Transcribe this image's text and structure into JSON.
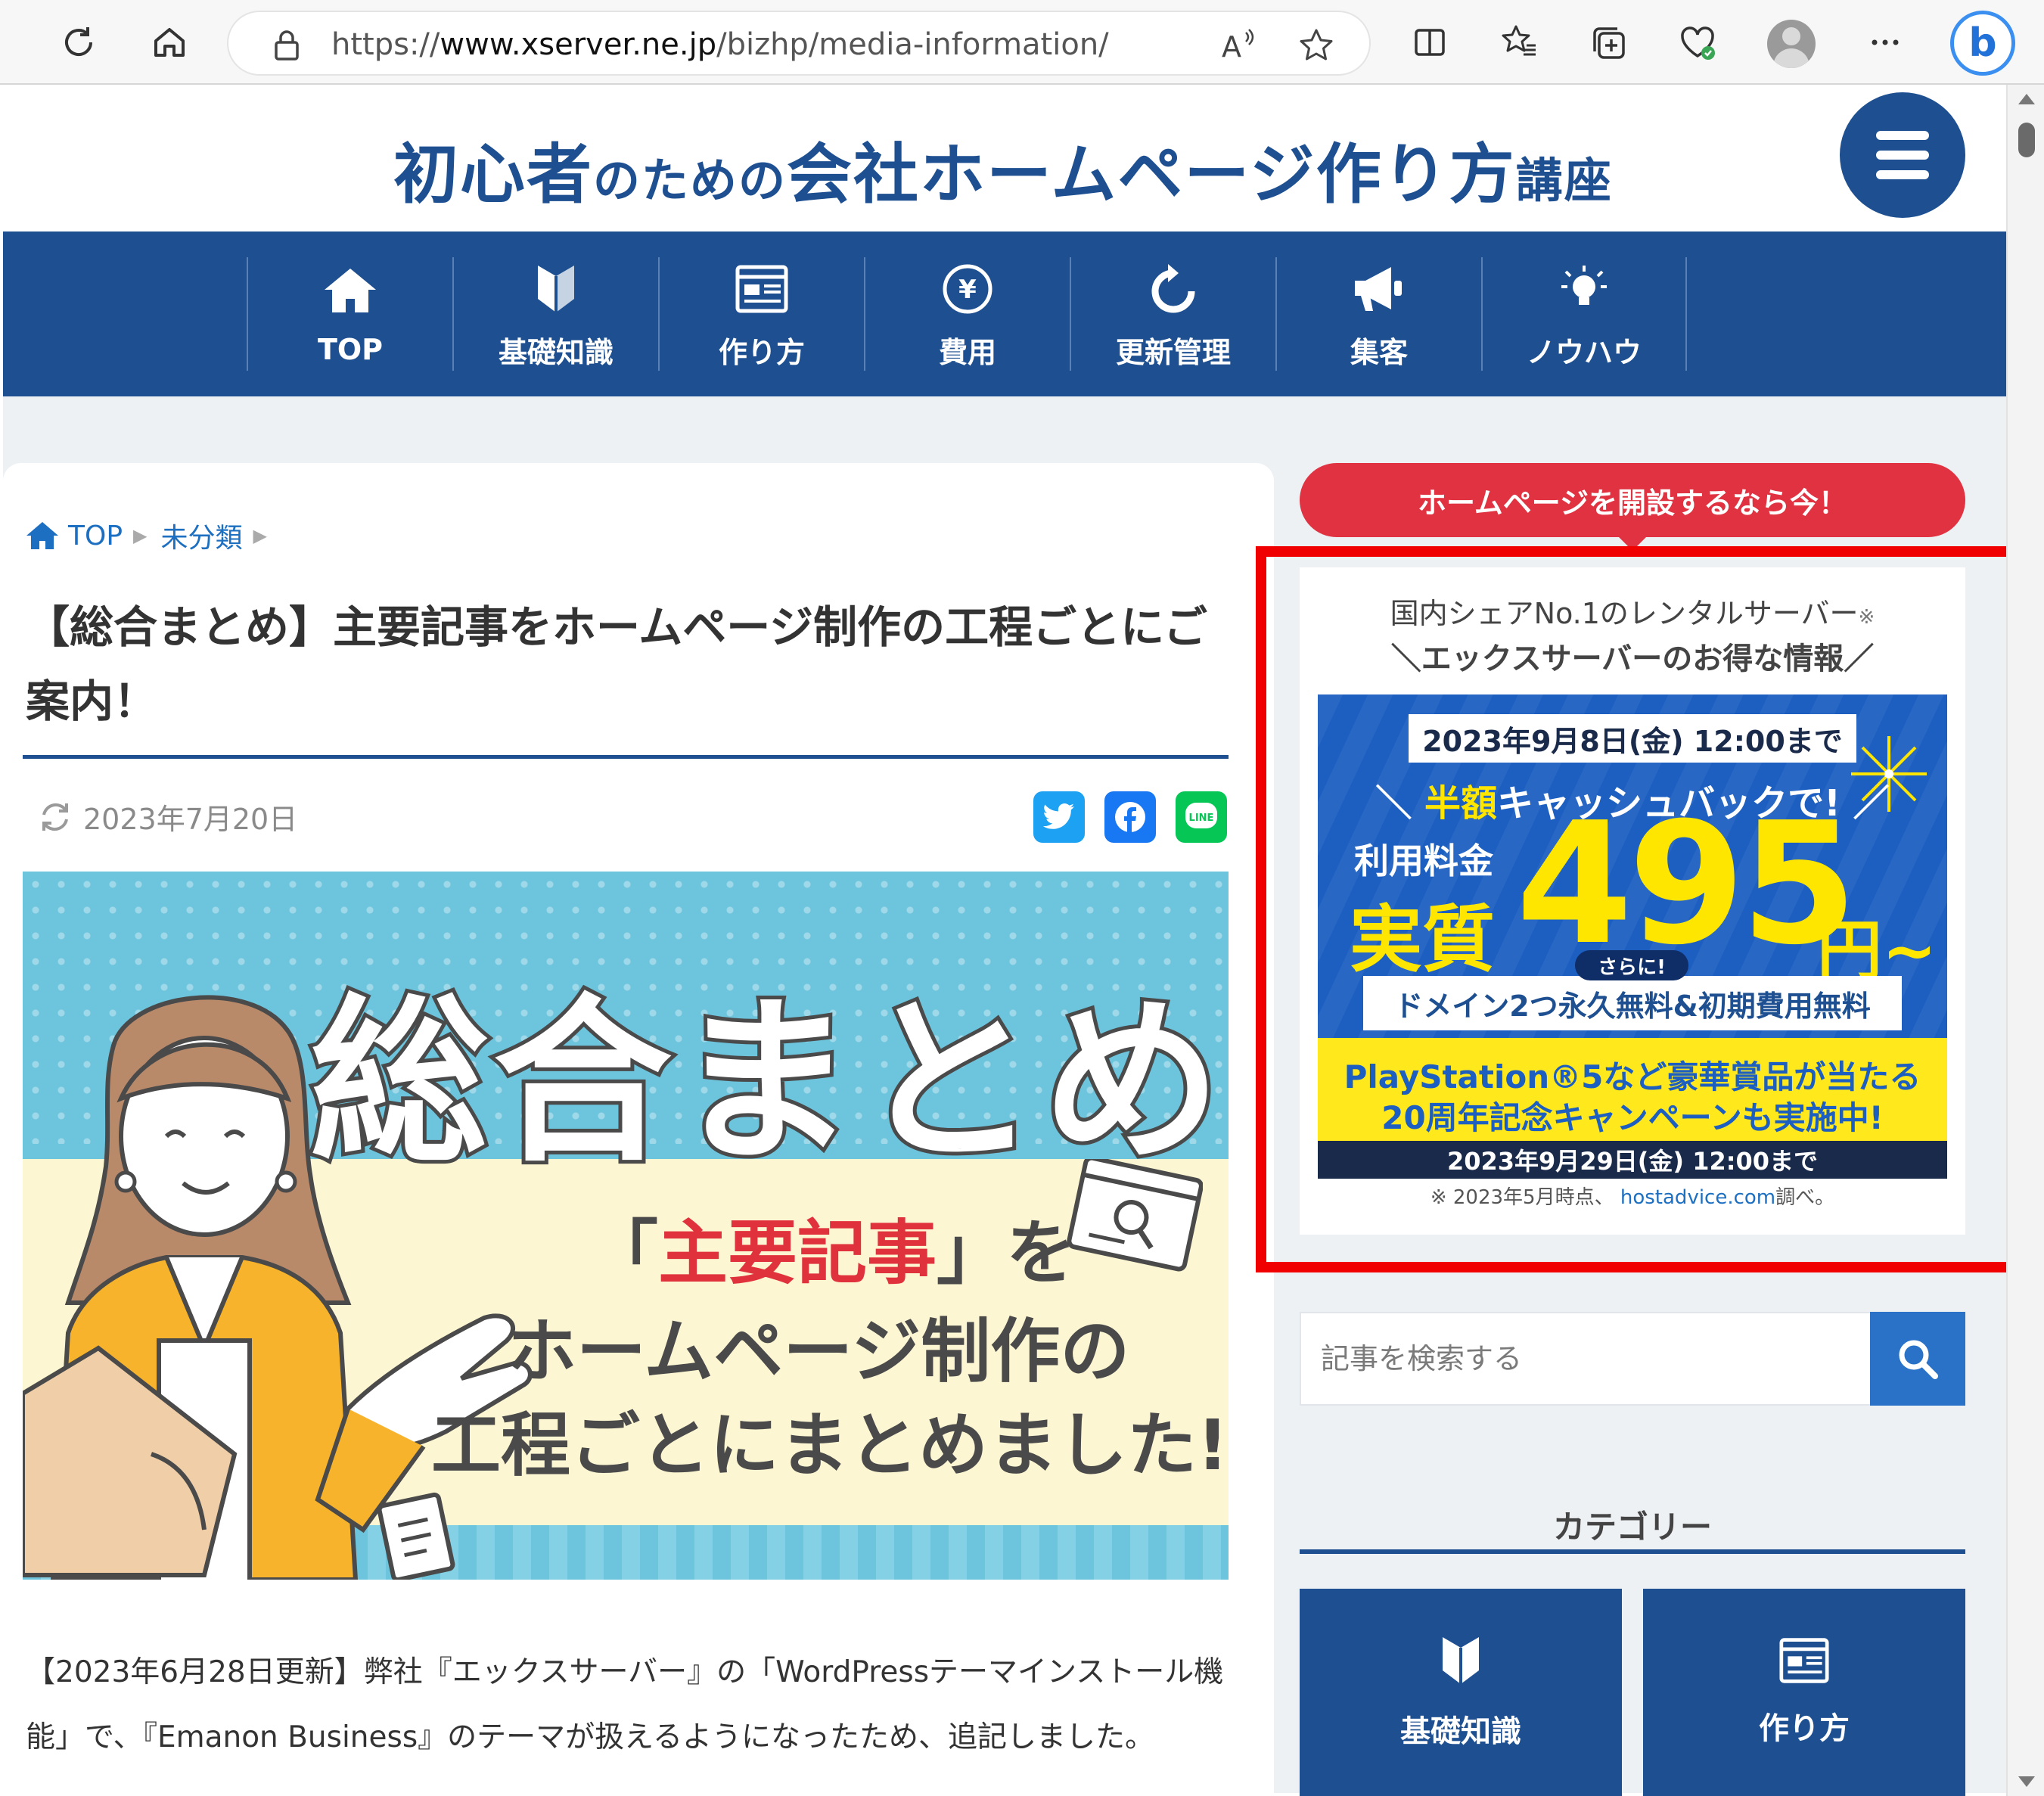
{
  "browser": {
    "url_prefix": "https://",
    "url_host": "www.xserver.ne.jp",
    "url_path": "/bizhp/media-information/",
    "icons": [
      "refresh-icon",
      "home-icon",
      "lock-icon",
      "read-aloud-icon",
      "favorite-star-icon",
      "split-screen-icon",
      "favorites-icon",
      "collections-icon",
      "browser-essentials-icon",
      "profile-avatar",
      "more-icon",
      "bing-copilot-icon"
    ]
  },
  "header": {
    "logo_part1": "初心者",
    "logo_part2": "のための",
    "logo_part3": "会社ホームページ作り方",
    "logo_part4": "講座"
  },
  "nav": {
    "items": [
      {
        "label": "TOP",
        "icon": "house-icon"
      },
      {
        "label": "基礎知識",
        "icon": "beginner-mark-icon"
      },
      {
        "label": "作り方",
        "icon": "webpage-icon"
      },
      {
        "label": "費用",
        "icon": "yen-coin-icon"
      },
      {
        "label": "更新管理",
        "icon": "refresh-icon"
      },
      {
        "label": "集客",
        "icon": "megaphone-icon"
      },
      {
        "label": "ノウハウ",
        "icon": "lightbulb-icon"
      }
    ]
  },
  "breadcrumb": {
    "home": "TOP",
    "category": "未分類"
  },
  "article": {
    "title": "【総合まとめ】主要記事をホームページ制作の工程ごとにご案内！",
    "date": "2023年7月20日",
    "hero_big": "総合まとめ",
    "hero_line1_open": "「",
    "hero_line1_red": "主要記事",
    "hero_line1_close": "」を",
    "hero_line2": "ホームページ制作の",
    "hero_line3": "工程ごとにまとめました!",
    "body": "【2023年6月28日更新】弊社『エックスサーバー』の「WordPressテーマインストール機能」で、『Emanon Business』のテーマが扱えるようになったため、追記しました。"
  },
  "share": {
    "twitter": "twitter-icon",
    "facebook": "facebook-icon",
    "line": "line-icon"
  },
  "sidebar": {
    "ribbon": "ホームページを開設するなら今！",
    "caption1": "国内シェアNo.1のレンタルサーバー",
    "caption1_mark": "※",
    "caption2": "＼エックスサーバーのお得な情報／",
    "ad": {
      "deadline": "2023年9月8日(金) 12:00まで",
      "cashback_pre": "＼ ",
      "cashback_y": "半額",
      "cashback_rest": "キャッシュバックで! ／",
      "label_small": "利用料金",
      "label_big": "実質",
      "price": "495",
      "yen": "円~",
      "sarani": "さらに!",
      "domain": "ドメイン2つ永久無料&初期費用無料",
      "ps_line1": "PlayStation®5など豪華賞品が当たる",
      "ps_line2": "20周年記念キャンペーンも実施中!",
      "ps_deadline": "2023年9月29日(金) 12:00まで"
    },
    "note_pre": "※ 2023年5月時点、",
    "note_link": "hostadvice.com",
    "note_post": "調べ。",
    "search_placeholder": "記事を検索する",
    "category_title": "カテゴリー",
    "category_tiles": [
      {
        "label": "基礎知識",
        "icon": "beginner-mark-icon"
      },
      {
        "label": "作り方",
        "icon": "webpage-icon"
      }
    ]
  },
  "colors": {
    "brand_navy": "#1d4f91",
    "ribbon_red": "#e03240",
    "highlight_red": "#f00000",
    "ad_yellow": "#ffe600"
  }
}
